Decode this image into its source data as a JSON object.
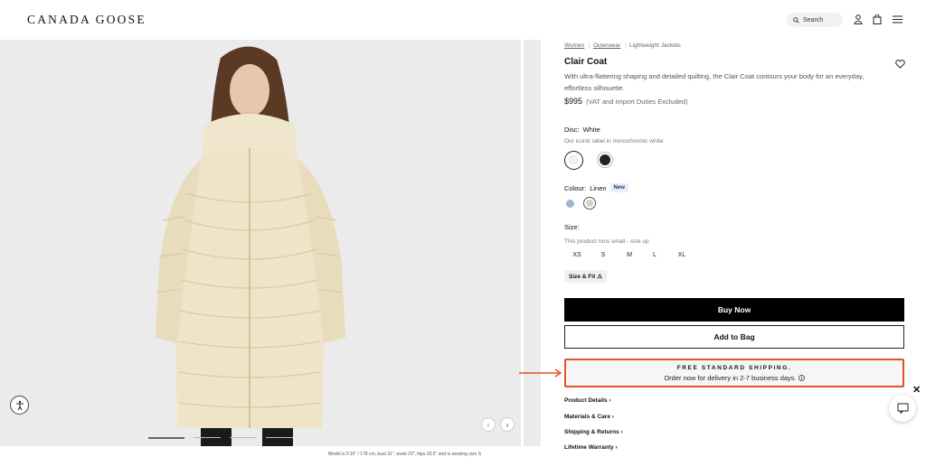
{
  "header": {
    "logo": "CANADA GOOSE",
    "search_label": "Search"
  },
  "breadcrumb": [
    "Women",
    "Outerwear",
    "Lightweight Jackets"
  ],
  "product": {
    "title": "Clair Coat",
    "description": "With ultra-flattering shaping and detailed quilting, the Clair Coat contours your body for an everyday, effortless silhouette.",
    "price": "$995",
    "price_note": "(VAT and Import Duties Excluded)"
  },
  "disc": {
    "label": "Disc:",
    "value": "White",
    "note": "Our iconic label in monochromic white"
  },
  "colour": {
    "label": "Colour:",
    "value": "Linen",
    "badge": "New",
    "swatches": [
      "#9fb6cc",
      "#d6d2c2"
    ]
  },
  "size": {
    "label": "Size:",
    "note": "This product runs small - size up",
    "options": [
      "XS",
      "S",
      "M",
      "L",
      "XL"
    ],
    "fit_label": "Size & Fit"
  },
  "actions": {
    "buy_now": "Buy Now",
    "add_to_bag": "Add to Bag"
  },
  "shipping": {
    "title": "FREE STANDARD SHIPPING.",
    "subtitle": "Order now for delivery in 2-7 business days."
  },
  "accordion": [
    "Product Details",
    "Materials & Care",
    "Shipping & Returns",
    "Lifetime Warranty"
  ],
  "caption": "Model is 5'10\" / 178 cm, bust 31\", waist 23\", hips 33.5\" and is wearing size S",
  "colors": {
    "highlight": "#e0502a",
    "primary_button": "#000000",
    "image_bg": "#ebebeb"
  }
}
